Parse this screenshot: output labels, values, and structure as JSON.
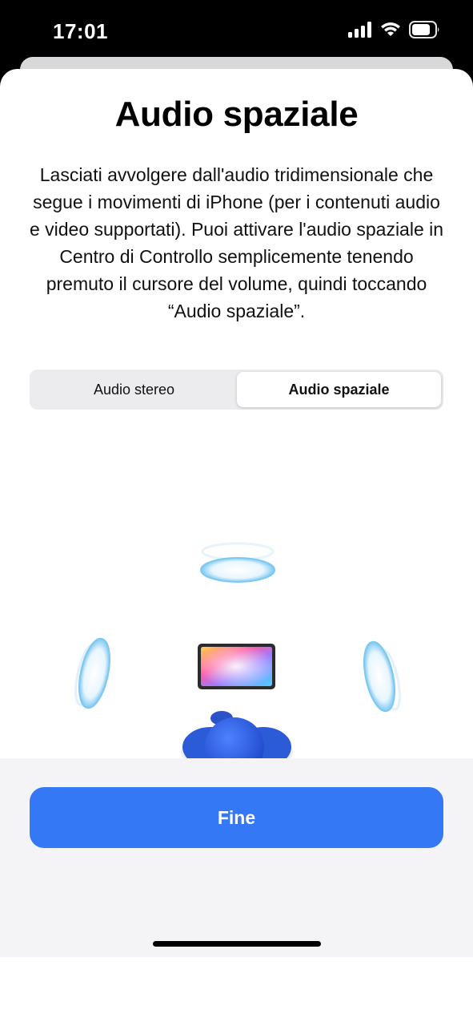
{
  "status_bar": {
    "time": "17:01",
    "icons": [
      "cellular-signal-icon",
      "wifi-icon",
      "battery-icon"
    ]
  },
  "sheet": {
    "title": "Audio spaziale",
    "description": "Lasciati avvolgere dall'audio tridimensionale che segue i movimenti di iPhone (per i contenuti audio e video supportati). Puoi attivare l'audio spaziale in Centro di Controllo semplicemente tenendo premuto il cursore del volume, quindi toccando “Audio spaziale”.",
    "segmented_control": {
      "options": [
        "Audio stereo",
        "Audio spaziale"
      ],
      "selected": "Audio spaziale"
    },
    "illustration": {
      "elements": [
        "speaker-ring-top",
        "speaker-ring-left",
        "speaker-ring-right",
        "ipad-screen",
        "listener-head",
        "speaker-ring-bottom-left",
        "speaker-ring-bottom-right"
      ]
    },
    "done_label": "Fine"
  },
  "colors": {
    "accent": "#3478f6",
    "listener_blue": "#2f5fe0",
    "ring_blue": "#8fd0f5"
  }
}
